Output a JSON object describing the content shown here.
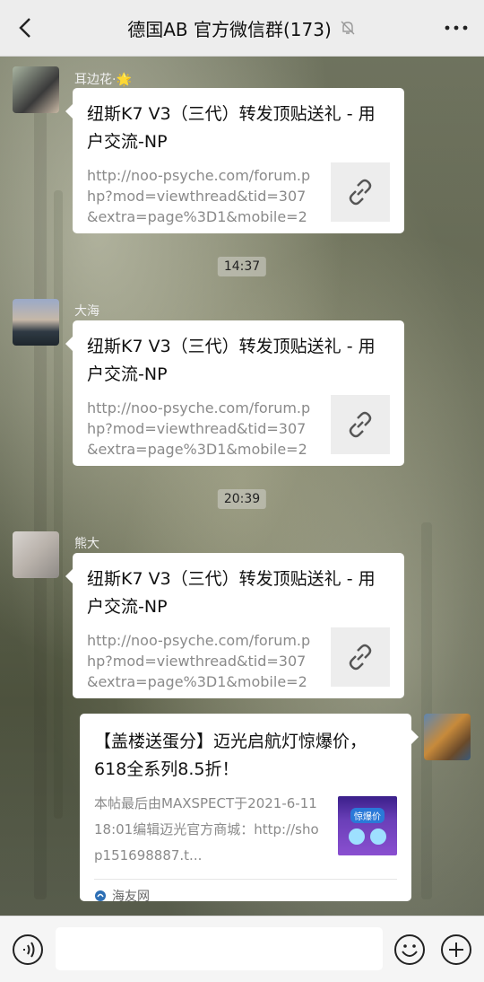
{
  "header": {
    "back_icon": "back-chevron-icon",
    "title": "德国AB  官方微信群(173)",
    "mute_icon": "bell-muted-icon",
    "more_icon": "more-dots-icon"
  },
  "messages": [
    {
      "sender": "耳边花·🌟",
      "title": "纽斯K7 V3（三代）转发顶贴送礼 - 用户交流-NP",
      "desc": "http://noo-psyche.com/forum.php?mod=viewthread&tid=307&extra=page%3D1&mobile=2",
      "thumb_icon": "link-icon"
    },
    {
      "sender": "大海",
      "title": "纽斯K7 V3（三代）转发顶贴送礼 - 用户交流-NP",
      "desc": "http://noo-psyche.com/forum.php?mod=viewthread&tid=307&extra=page%3D1&mobile=2",
      "thumb_icon": "link-icon"
    },
    {
      "sender": "熊大",
      "title": "纽斯K7 V3（三代）转发顶贴送礼 - 用户交流-NP",
      "desc": "http://noo-psyche.com/forum.php?mod=viewthread&tid=307&extra=page%3D1&mobile=2",
      "thumb_icon": "link-icon"
    }
  ],
  "timestamps": [
    "14:37",
    "20:39"
  ],
  "self_message": {
    "title": "【盖楼送蛋分】迈光启航灯惊爆价，618全系列8.5折！",
    "desc": "本帖最后由MAXSPECT于2021-6-1118:01编辑迈光官方商城：http://shop151698887.t...",
    "source": "海友网",
    "thumb_text": "惊爆价"
  },
  "input_bar": {
    "voice_icon": "voice-icon",
    "emoji_icon": "emoji-icon",
    "plus_icon": "plus-icon"
  }
}
